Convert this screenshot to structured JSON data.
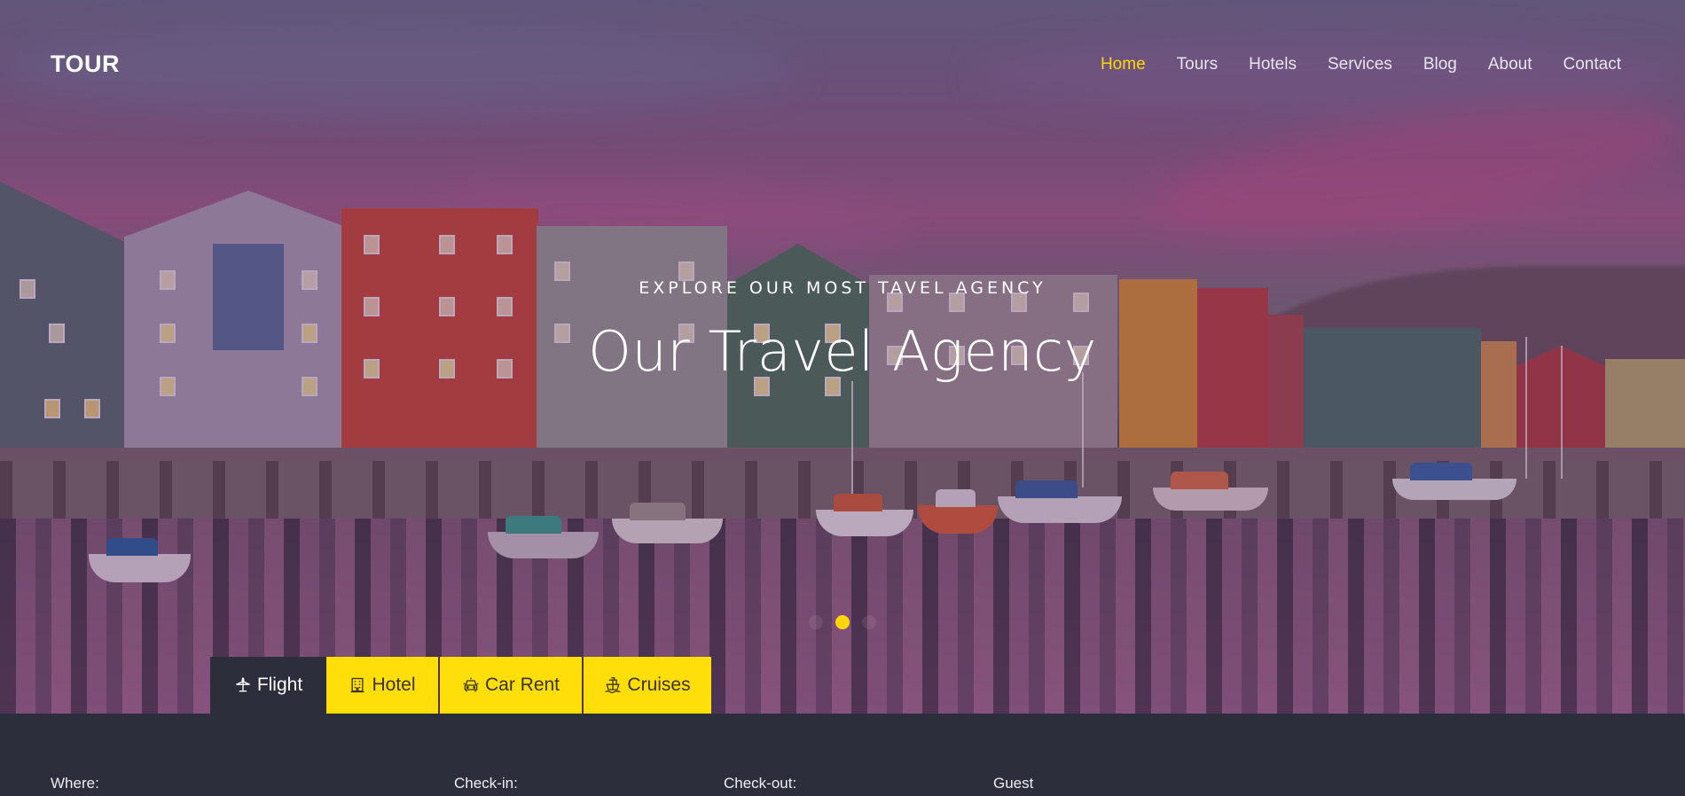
{
  "brand": {
    "logo": "TOUR"
  },
  "nav": {
    "items": [
      {
        "label": "Home",
        "active": true
      },
      {
        "label": "Tours",
        "active": false
      },
      {
        "label": "Hotels",
        "active": false
      },
      {
        "label": "Services",
        "active": false
      },
      {
        "label": "Blog",
        "active": false
      },
      {
        "label": "About",
        "active": false
      },
      {
        "label": "Contact",
        "active": false
      }
    ]
  },
  "hero": {
    "eyebrow": "EXPLORE OUR MOST TAVEL AGENCY",
    "title": "Our Travel Agency",
    "slider": {
      "slide_count": 3,
      "active_index": 1
    }
  },
  "booking_tabs": [
    {
      "label": "Flight",
      "icon": "airplane-icon",
      "active": true
    },
    {
      "label": "Hotel",
      "icon": "hotel-icon",
      "active": false
    },
    {
      "label": "Car Rent",
      "icon": "taxi-icon",
      "active": false
    },
    {
      "label": "Cruises",
      "icon": "ship-icon",
      "active": false
    }
  ],
  "search_form": {
    "where_label": "Where:",
    "checkin_label": "Check-in:",
    "checkout_label": "Check-out:",
    "guest_label": "Guest"
  },
  "colors": {
    "accent": "#ffd60a",
    "tab_yellow": "#ffde0a",
    "panel_bg": "#2c2e3b"
  }
}
